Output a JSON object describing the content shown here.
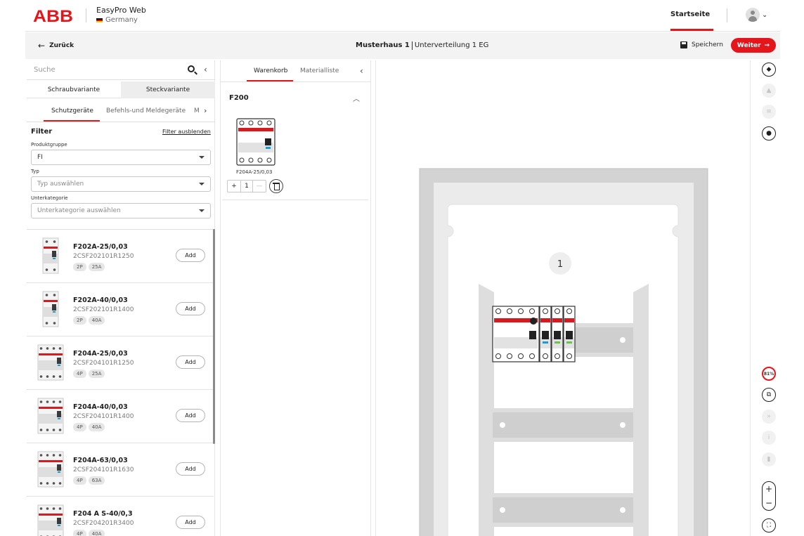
{
  "header": {
    "brand": "ABB",
    "app_title": "EasyPro Web",
    "country": "Germany",
    "nav_home": "Startseite"
  },
  "subheader": {
    "back_label": "Zurück",
    "project": "Musterhaus 1",
    "distribution": "Unterverteilung 1 EG",
    "save_label": "Speichern",
    "next_label": "Weiter"
  },
  "left": {
    "search_placeholder": "Suche",
    "variants": [
      "Schraubvariante",
      "Steckvariante"
    ],
    "categories": [
      "Schutzgeräte",
      "Befehls-und Meldegeräte",
      "M"
    ],
    "filter_title": "Filter",
    "filter_hide": "Filter ausblenden",
    "filters": [
      {
        "label": "Produktgruppe",
        "value": "FI",
        "placeholder": false
      },
      {
        "label": "Typ",
        "value": "Typ auswählen",
        "placeholder": true
      },
      {
        "label": "Unterkategorie",
        "value": "Unterkategorie auswählen",
        "placeholder": true
      }
    ],
    "add_label": "Add",
    "products": [
      {
        "name": "F202A-25/0,03",
        "code": "2CSF202101R1250",
        "tags": [
          "2P",
          "25A"
        ],
        "poles": 2
      },
      {
        "name": "F202A-40/0,03",
        "code": "2CSF202101R1400",
        "tags": [
          "2P",
          "40A"
        ],
        "poles": 2
      },
      {
        "name": "F204A-25/0,03",
        "code": "2CSF204101R1250",
        "tags": [
          "4P",
          "25A"
        ],
        "poles": 4
      },
      {
        "name": "F204A-40/0,03",
        "code": "2CSF204101R1400",
        "tags": [
          "4P",
          "40A"
        ],
        "poles": 4
      },
      {
        "name": "F204A-63/0,03",
        "code": "2CSF204101R1630",
        "tags": [
          "4P",
          "63A"
        ],
        "poles": 4
      },
      {
        "name": "F204 A S-40/0,3",
        "code": "2CSF204201R3400",
        "tags": [
          "4P",
          "40A"
        ],
        "poles": 4
      }
    ]
  },
  "middle": {
    "tabs": [
      "Warenkorb",
      "Materialliste"
    ],
    "group_title": "F200",
    "cart_item": {
      "name": "F204A-25/0,03",
      "qty": "1"
    }
  },
  "canvas": {
    "row_badge": "1"
  },
  "toolbar": {
    "zoom_percent": "81%"
  },
  "colors": {
    "accent": "#e4161b",
    "rail": "#dcdcdc",
    "enclosure": "#d2d2d2"
  }
}
